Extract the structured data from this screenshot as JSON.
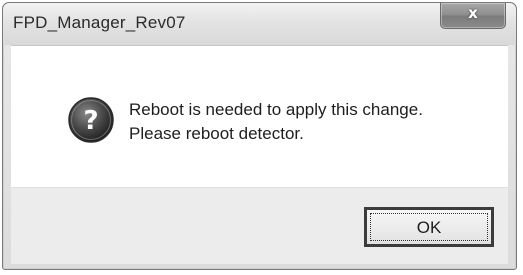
{
  "window": {
    "title": "FPD_Manager_Rev07",
    "close_glyph": "x"
  },
  "dialog": {
    "icon": "question-icon",
    "message_line1": "Reboot is needed to apply this change.",
    "message_line2": "Please reboot detector.",
    "ok_label": "OK"
  },
  "colors": {
    "icon_fill": "#3a3a3a",
    "button_border": "#3c3c3c"
  }
}
